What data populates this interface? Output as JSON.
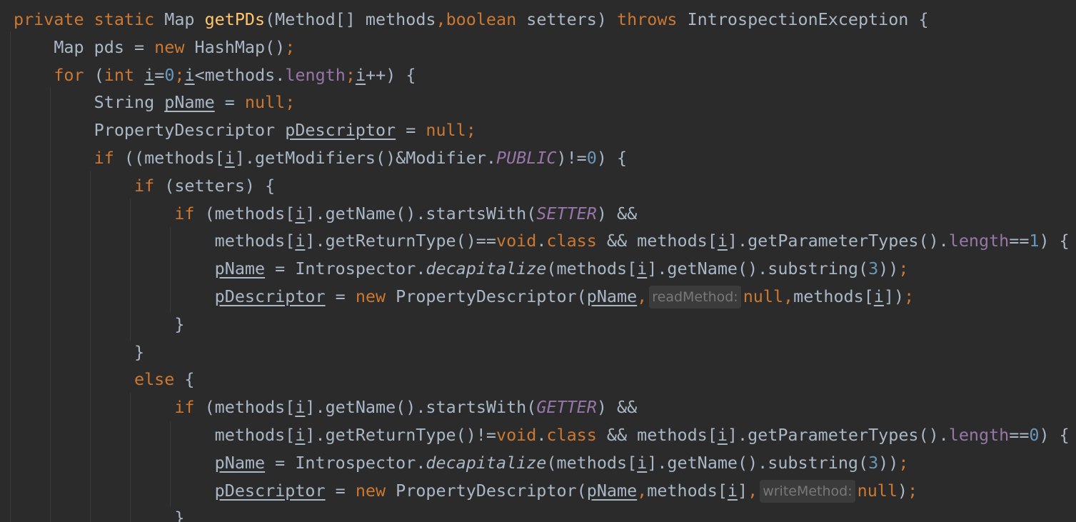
{
  "editor": {
    "lines": [
      [
        {
          "t": "private static ",
          "c": "kw"
        },
        {
          "t": "Map "
        },
        {
          "t": "getPDs",
          "c": "fn"
        },
        {
          "t": "(Method[] methods"
        },
        {
          "t": ",boolean ",
          "c": "kw"
        },
        {
          "t": "setters) "
        },
        {
          "t": "throws ",
          "c": "kw"
        },
        {
          "t": "IntrospectionException {"
        }
      ],
      [
        {
          "t": "    Map pds = "
        },
        {
          "t": "new ",
          "c": "kw"
        },
        {
          "t": "HashMap()"
        },
        {
          "t": ";",
          "c": "kw"
        }
      ],
      [
        {
          "t": "    "
        },
        {
          "t": "for ",
          "c": "kw"
        },
        {
          "t": "("
        },
        {
          "t": "int ",
          "c": "kw"
        },
        {
          "t": "i",
          "c": "ul"
        },
        {
          "t": "="
        },
        {
          "t": "0",
          "c": "num"
        },
        {
          "t": ";",
          "c": "kw"
        },
        {
          "t": "i",
          "c": "ul"
        },
        {
          "t": "<methods."
        },
        {
          "t": "length",
          "c": "fld"
        },
        {
          "t": ";",
          "c": "kw"
        },
        {
          "t": "i",
          "c": "ul"
        },
        {
          "t": "++) {"
        }
      ],
      [
        {
          "t": "        String "
        },
        {
          "t": "pName",
          "c": "ul"
        },
        {
          "t": " = "
        },
        {
          "t": "null;",
          "c": "kw"
        }
      ],
      [
        {
          "t": "        PropertyDescriptor "
        },
        {
          "t": "pDescriptor",
          "c": "ul"
        },
        {
          "t": " = "
        },
        {
          "t": "null;",
          "c": "kw"
        }
      ],
      [
        {
          "t": "        "
        },
        {
          "t": "if ",
          "c": "kw"
        },
        {
          "t": "((methods["
        },
        {
          "t": "i",
          "c": "ul"
        },
        {
          "t": "].getModifiers()&Modifier."
        },
        {
          "t": "PUBLIC",
          "c": "const"
        },
        {
          "t": ")!="
        },
        {
          "t": "0",
          "c": "num"
        },
        {
          "t": ") {"
        }
      ],
      [
        {
          "t": "            "
        },
        {
          "t": "if ",
          "c": "kw"
        },
        {
          "t": "(setters) {"
        }
      ],
      [
        {
          "t": "                "
        },
        {
          "t": "if ",
          "c": "kw"
        },
        {
          "t": "(methods["
        },
        {
          "t": "i",
          "c": "ul"
        },
        {
          "t": "].getName().startsWith("
        },
        {
          "t": "SETTER",
          "c": "const"
        },
        {
          "t": ") &&"
        }
      ],
      [
        {
          "t": "                    methods["
        },
        {
          "t": "i",
          "c": "ul"
        },
        {
          "t": "].getReturnType()=="
        },
        {
          "t": "void",
          "c": "kw"
        },
        {
          "t": "."
        },
        {
          "t": "class ",
          "c": "kw"
        },
        {
          "t": "&& methods["
        },
        {
          "t": "i",
          "c": "ul"
        },
        {
          "t": "].getParameterTypes()."
        },
        {
          "t": "length",
          "c": "fld"
        },
        {
          "t": "=="
        },
        {
          "t": "1",
          "c": "num"
        },
        {
          "t": ") {"
        }
      ],
      [
        {
          "t": "                    "
        },
        {
          "t": "pName",
          "c": "ul"
        },
        {
          "t": " = Introspector."
        },
        {
          "t": "decapitalize",
          "c": "it"
        },
        {
          "t": "(methods["
        },
        {
          "t": "i",
          "c": "ul"
        },
        {
          "t": "].getName().substring("
        },
        {
          "t": "3",
          "c": "num"
        },
        {
          "t": "))"
        },
        {
          "t": ";",
          "c": "kw"
        }
      ],
      [
        {
          "t": "                    "
        },
        {
          "t": "pDescriptor",
          "c": "ul"
        },
        {
          "t": " = "
        },
        {
          "t": "new ",
          "c": "kw"
        },
        {
          "t": "PropertyDescriptor("
        },
        {
          "t": "pName",
          "c": "ul"
        },
        {
          "t": ",",
          "c": "kw"
        },
        {
          "t": "readMethod:",
          "c": "hint"
        },
        {
          "t": "null,",
          "c": "kw"
        },
        {
          "t": "methods["
        },
        {
          "t": "i",
          "c": "ul"
        },
        {
          "t": "])"
        },
        {
          "t": ";",
          "c": "kw"
        }
      ],
      [
        {
          "t": "                }"
        }
      ],
      [
        {
          "t": "            }"
        }
      ],
      [
        {
          "t": "            "
        },
        {
          "t": "else ",
          "c": "kw"
        },
        {
          "t": "{"
        }
      ],
      [
        {
          "t": "                "
        },
        {
          "t": "if ",
          "c": "kw"
        },
        {
          "t": "(methods["
        },
        {
          "t": "i",
          "c": "ul"
        },
        {
          "t": "].getName().startsWith("
        },
        {
          "t": "GETTER",
          "c": "const"
        },
        {
          "t": ") &&"
        }
      ],
      [
        {
          "t": "                    methods["
        },
        {
          "t": "i",
          "c": "ul"
        },
        {
          "t": "].getReturnType()!="
        },
        {
          "t": "void",
          "c": "kw"
        },
        {
          "t": "."
        },
        {
          "t": "class ",
          "c": "kw"
        },
        {
          "t": "&& methods["
        },
        {
          "t": "i",
          "c": "ul"
        },
        {
          "t": "].getParameterTypes()."
        },
        {
          "t": "length",
          "c": "fld"
        },
        {
          "t": "=="
        },
        {
          "t": "0",
          "c": "num"
        },
        {
          "t": ") {"
        }
      ],
      [
        {
          "t": "                    "
        },
        {
          "t": "pName",
          "c": "ul"
        },
        {
          "t": " = Introspector."
        },
        {
          "t": "decapitalize",
          "c": "it"
        },
        {
          "t": "(methods["
        },
        {
          "t": "i",
          "c": "ul"
        },
        {
          "t": "].getName().substring("
        },
        {
          "t": "3",
          "c": "num"
        },
        {
          "t": "))"
        },
        {
          "t": ";",
          "c": "kw"
        }
      ],
      [
        {
          "t": "                    "
        },
        {
          "t": "pDescriptor",
          "c": "ul"
        },
        {
          "t": " = "
        },
        {
          "t": "new ",
          "c": "kw"
        },
        {
          "t": "PropertyDescriptor("
        },
        {
          "t": "pName",
          "c": "ul"
        },
        {
          "t": ",",
          "c": "kw"
        },
        {
          "t": "methods["
        },
        {
          "t": "i",
          "c": "ul"
        },
        {
          "t": "]"
        },
        {
          "t": ",",
          "c": "kw"
        },
        {
          "t": "writeMethod:",
          "c": "hint"
        },
        {
          "t": "null",
          "c": "kw"
        },
        {
          "t": ")"
        },
        {
          "t": ";",
          "c": "kw"
        }
      ],
      [
        {
          "t": "                }"
        }
      ]
    ]
  },
  "colors": {
    "background": "#2b2b2b",
    "default_text": "#a9b7c6",
    "keyword": "#cc7832",
    "method_declaration": "#ffc66d",
    "field": "#9876aa",
    "number": "#6897bb",
    "inlay_hint_text": "#787878",
    "inlay_hint_background": "#3b3b3b"
  }
}
